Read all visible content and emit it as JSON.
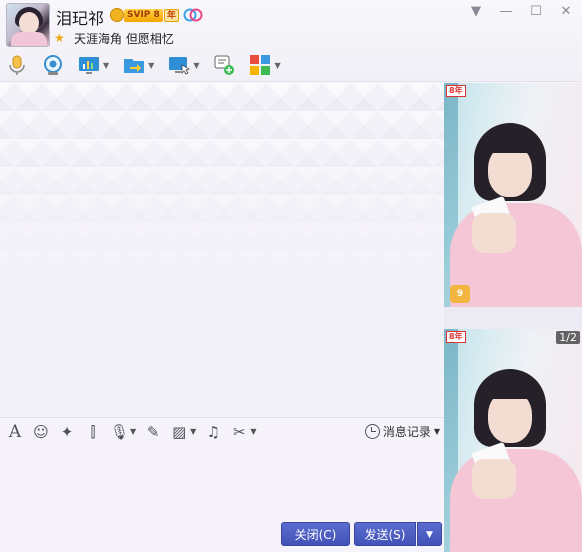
{
  "header": {
    "nickname": "泪玘祁",
    "vip_badge": "SVIP 8",
    "year_badge": "年",
    "signature": "天涯海角 但愿相忆"
  },
  "window_controls": {
    "dropdown_icon": "chevron-down-icon",
    "minimize_icon": "minimize-icon",
    "maximize_icon": "maximize-icon",
    "close_icon": "close-icon"
  },
  "toolbar": {
    "items": [
      {
        "name": "voice-call",
        "icon": "microphone-icon"
      },
      {
        "name": "video-call",
        "icon": "camera-icon"
      },
      {
        "name": "screen-share",
        "icon": "monitor-chart-icon"
      },
      {
        "name": "send-file",
        "icon": "folder-arrow-icon"
      },
      {
        "name": "remote-desktop",
        "icon": "remote-monitor-icon"
      },
      {
        "name": "create-group",
        "icon": "chat-add-icon"
      },
      {
        "name": "apps",
        "icon": "apps-grid-icon"
      }
    ]
  },
  "input_toolbar": {
    "history_label": "消息记录"
  },
  "buttons": {
    "close_label": "关闭(C)",
    "send_label": "发送(S)"
  },
  "right_panel": {
    "badge1": "8年",
    "badge2": "8年",
    "thumb_count": "9",
    "page_indicator": "1/2"
  }
}
